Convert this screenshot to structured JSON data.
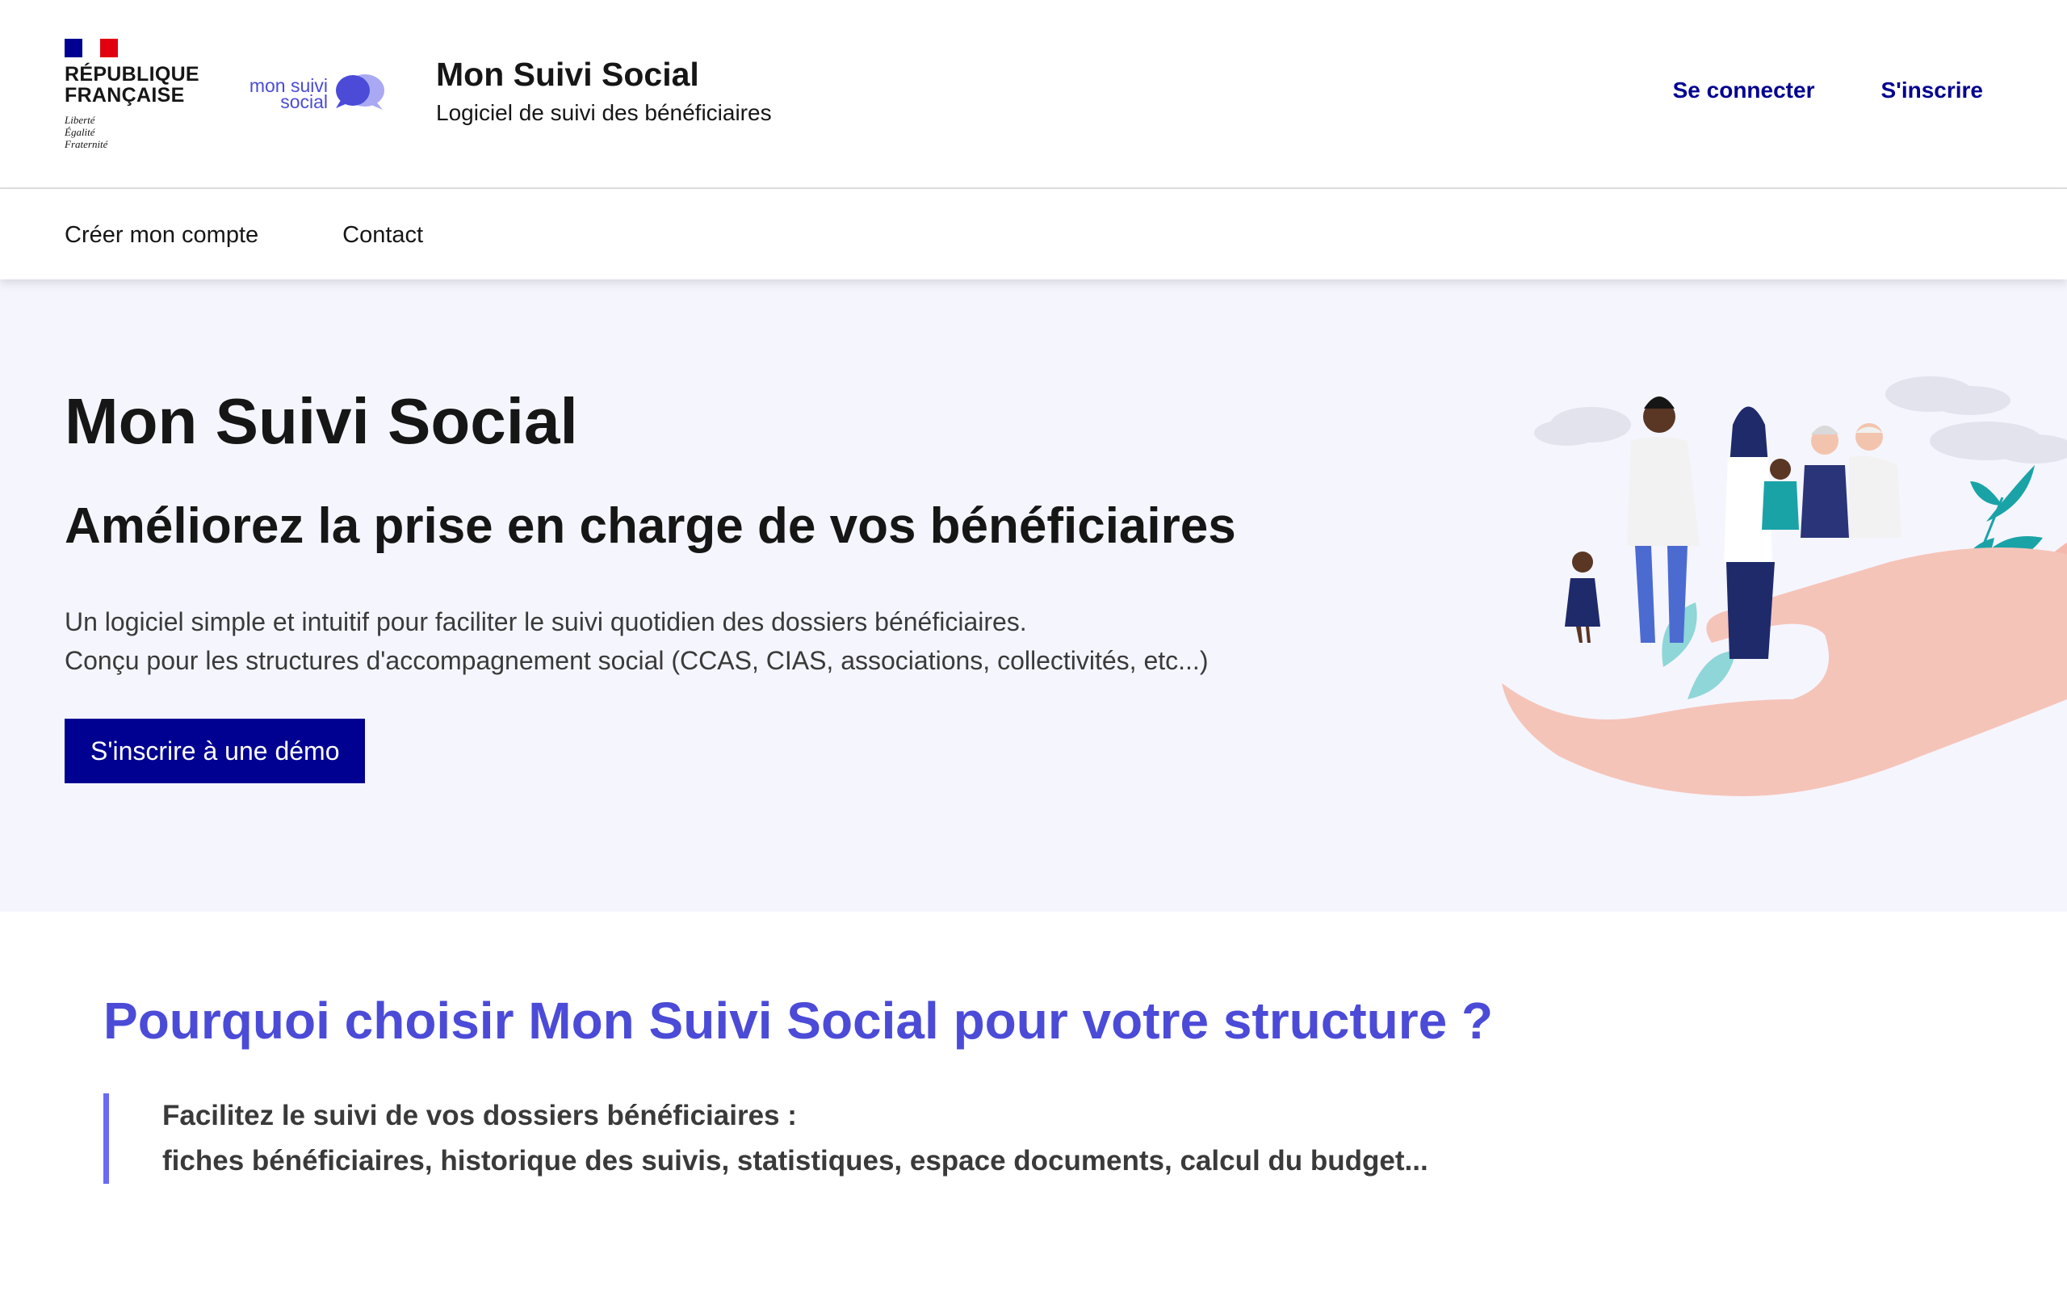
{
  "header": {
    "republic_line1": "RÉPUBLIQUE",
    "republic_line2": "FRANÇAISE",
    "motto": [
      "Liberté",
      "Égalité",
      "Fraternité"
    ],
    "logo_text_line1": "mon suivi",
    "logo_text_line2": "social",
    "service_title": "Mon Suivi Social",
    "service_tagline": "Logiciel de suivi des bénéficiaires",
    "links": {
      "login": "Se connecter",
      "signup": "S'inscrire"
    }
  },
  "nav": {
    "items": [
      {
        "label": "Créer mon compte"
      },
      {
        "label": "Contact"
      }
    ]
  },
  "hero": {
    "title": "Mon Suivi Social",
    "subtitle": "Améliorez la prise en charge de vos bénéficiaires",
    "description_line1": "Un logiciel simple et intuitif pour faciliter le suivi quotidien des dossiers bénéficiaires.",
    "description_line2": "Conçu pour les structures d'accompagnement social (CCAS, CIAS, associations, collectivités, etc...)",
    "cta_label": "S'inscrire à une démo"
  },
  "why": {
    "title": "Pourquoi choisir Mon Suivi Social pour votre structure ?",
    "quote_line1": "Facilitez le suivi de vos dossiers bénéficiaires :",
    "quote_line2": "fiches bénéficiaires, historique des suivis, statistiques, espace documents, calcul du budget..."
  },
  "colors": {
    "primary": "#000091",
    "accent": "#4b4bd8",
    "hero_bg": "#f5f5fe",
    "quote_border": "#6a6af4"
  },
  "icons": {
    "logo_bubble": "speech-bubble-icon",
    "illustration": "family-in-hand-illustration"
  }
}
